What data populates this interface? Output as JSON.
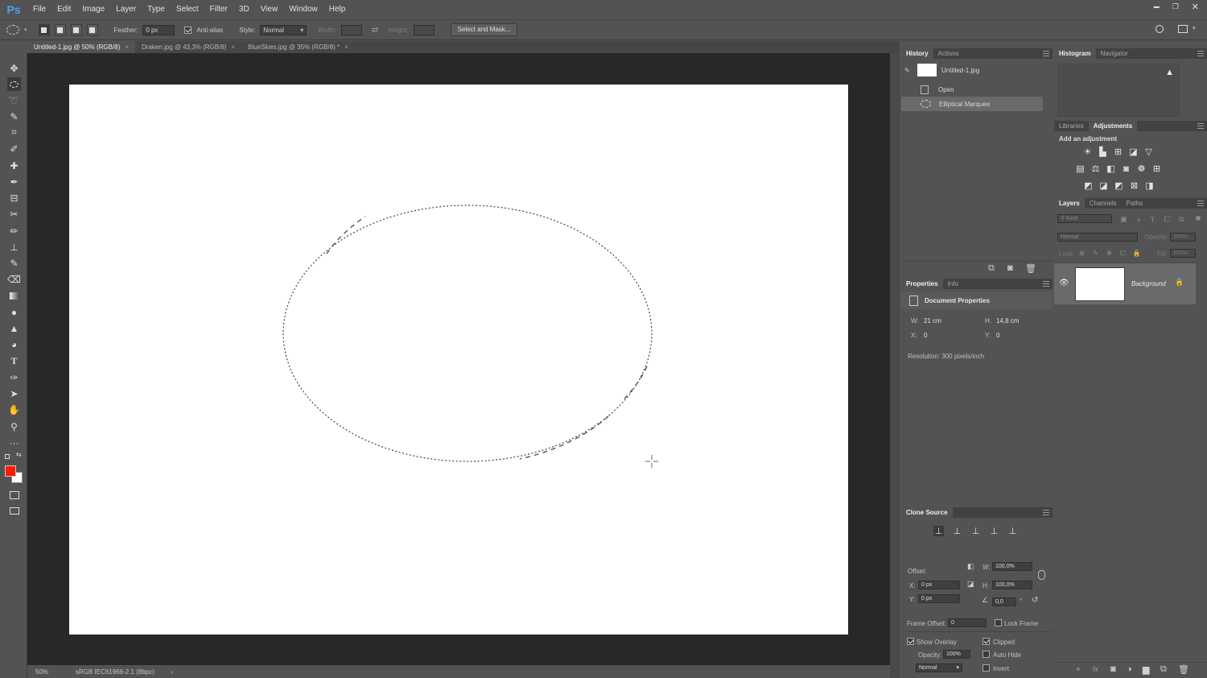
{
  "app": {
    "logo": "Ps"
  },
  "menu": [
    "File",
    "Edit",
    "Image",
    "Layer",
    "Type",
    "Select",
    "Filter",
    "3D",
    "View",
    "Window",
    "Help"
  ],
  "window_controls": {
    "minimize": "▬",
    "restore": "❐",
    "close": "✕"
  },
  "options_bar": {
    "feather_label": "Feather:",
    "feather_value": "0 px",
    "antialias_label": "Anti-alias",
    "antialias_checked": true,
    "style_label": "Style:",
    "style_value": "Normal",
    "width_label": "Width:",
    "height_label": "Height:",
    "select_mask_label": "Select and Mask..."
  },
  "tabs": [
    {
      "label": "Untitled-1.jpg @ 50% (RGB/8)",
      "close": "×",
      "active": true
    },
    {
      "label": "Draken.jpg @ 43,3% (RGB/8)",
      "close": "×",
      "active": false
    },
    {
      "label": "BlueSkies.jpg @ 35% (RGB/8) *",
      "close": "×",
      "active": false
    }
  ],
  "status_bar": {
    "zoom": "50%",
    "profile": "sRGB IEC61966-2.1 (8bpc)",
    "arrow": "›"
  },
  "history_panel": {
    "tabs": [
      "History",
      "Actions"
    ],
    "snapshot_label": "Untitled-1.jpg",
    "items": [
      {
        "label": "Open",
        "selected": false
      },
      {
        "label": "Elliptical Marquee",
        "selected": true
      }
    ]
  },
  "histogram_panel": {
    "tabs": [
      "Histogram",
      "Navigator"
    ],
    "warning": "▲"
  },
  "adjustments_panel": {
    "tabs": [
      "Libraries",
      "Adjustments"
    ],
    "title": "Add an adjustment"
  },
  "properties_panel": {
    "tabs": [
      "Properties",
      "Info"
    ],
    "title": "Document Properties",
    "w_label": "W:",
    "w_value": "21 cm",
    "h_label": "H:",
    "h_value": "14,8 cm",
    "x_label": "X:",
    "x_value": "0",
    "y_label": "Y:",
    "y_value": "0",
    "resolution": "Resolution: 300 pixels/inch"
  },
  "layers_panel": {
    "tabs": [
      "Layers",
      "Channels",
      "Paths"
    ],
    "kind_label": "Kind",
    "blend_mode": "Normal",
    "opacity_label": "Opacity:",
    "opacity_value": "100%",
    "lock_label": "Lock:",
    "fill_label": "Fill:",
    "fill_value": "100%",
    "layer_name": "Background"
  },
  "clone_source_panel": {
    "tabs": [
      "Clone Source"
    ],
    "offset_label": "Offset:",
    "w_label": "W:",
    "w_value": "100,0%",
    "h_label": "H:",
    "h_value": "100,0%",
    "x_label": "X:",
    "x_value": "0 px",
    "y_label": "Y:",
    "y_value": "0 px",
    "angle_value": "0,0",
    "degree": "°",
    "frame_offset_label": "Frame Offset:",
    "frame_offset_value": "0",
    "lock_frame_label": "Lock Frame",
    "show_overlay_label": "Show Overlay",
    "show_overlay_checked": true,
    "clipped_label": "Clipped",
    "clipped_checked": true,
    "opacity_label": "Opacity:",
    "opacity_value": "100%",
    "auto_hide_label": "Auto Hide",
    "mode_value": "Normal",
    "invert_label": "Invert"
  },
  "colors": {
    "foreground": "#ff1a00",
    "background": "#ffffff"
  }
}
